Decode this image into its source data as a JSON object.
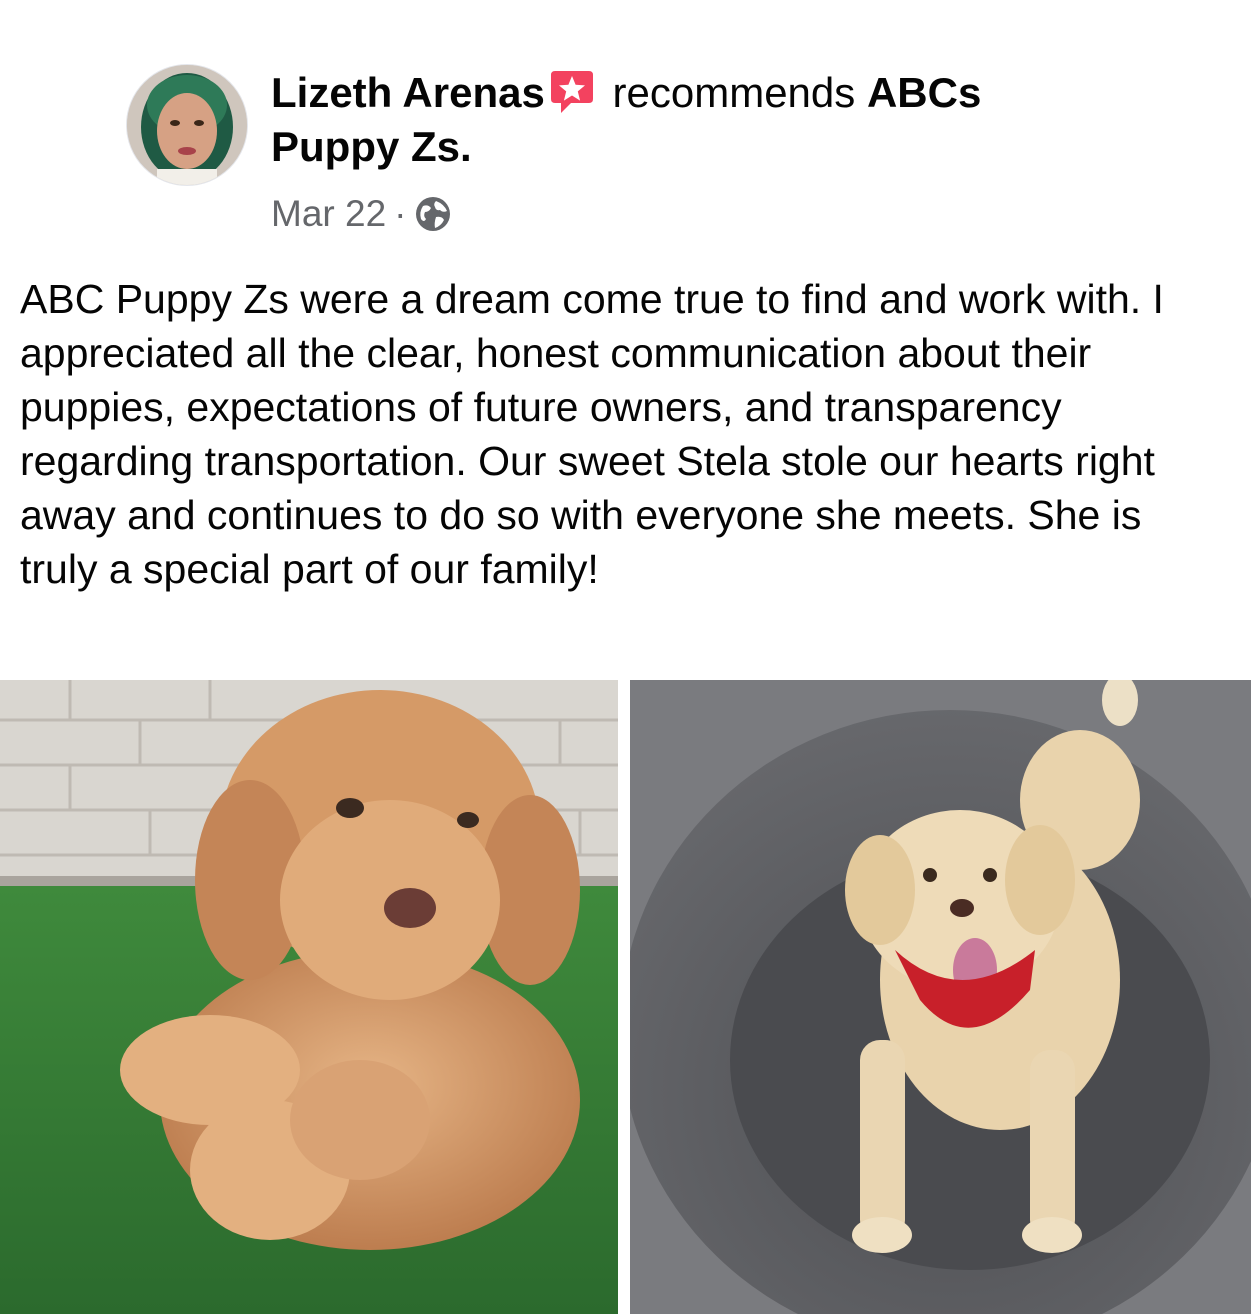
{
  "post": {
    "author_name": "Lizeth Arenas",
    "action_text": "recommends",
    "page_name_part1": "ABCs",
    "page_name_part2": "Puppy Zs.",
    "date": "Mar 22",
    "separator": "·",
    "privacy_icon": "globe-icon",
    "recommend_badge_icon": "recommendation-star-icon",
    "body": "ABC Puppy Zs were a dream come true to find and work with. I appreciated all the clear, honest communication about their puppies, expectations of future owners, and transparency regarding transportation. Our sweet Stela stole our hearts right away and continues to do so with everyone she meets. She is truly a special part of our family!"
  },
  "photos": [
    {
      "icon": "puppy-on-grass-photo"
    },
    {
      "icon": "dog-on-bed-photo"
    }
  ],
  "colors": {
    "text": "#050505",
    "meta": "#65676b",
    "badge": "#f3425f",
    "background": "#ffffff"
  }
}
